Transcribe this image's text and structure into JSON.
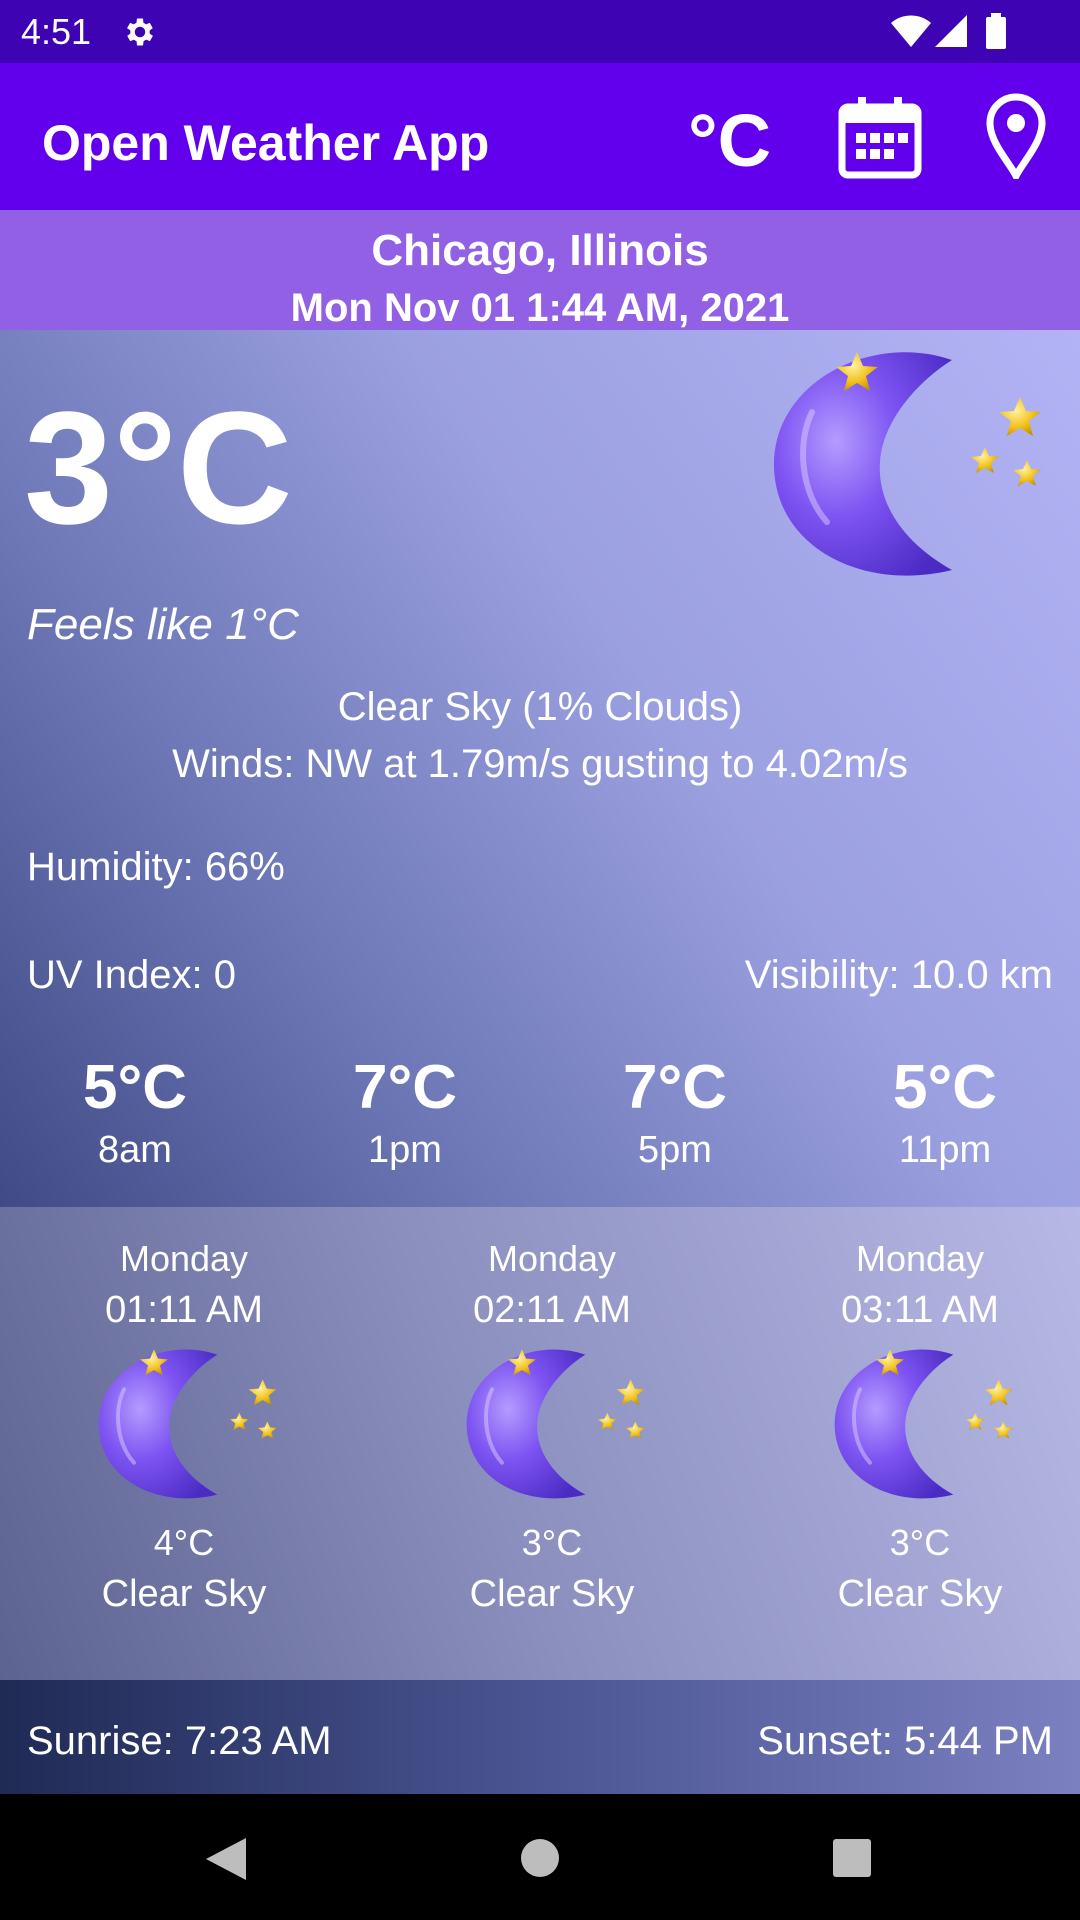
{
  "status_bar": {
    "time": "4:51",
    "icons": [
      "gear-icon",
      "wifi-icon",
      "signal-icon",
      "battery-icon"
    ]
  },
  "app_bar": {
    "title": "Open Weather App",
    "unit_toggle": "°C",
    "icons": [
      "calendar-icon",
      "location-pin-icon"
    ]
  },
  "location": {
    "city": "Chicago, Illinois",
    "datetime": "Mon Nov 01 1:44 AM, 2021"
  },
  "current": {
    "temperature": "3°C",
    "feels_like": "Feels like 1°C",
    "condition": "Clear Sky (1% Clouds)",
    "wind": "Winds: NW at 1.79m/s gusting to 4.02m/s",
    "humidity": "Humidity: 66%",
    "uv_index": "UV Index: 0",
    "visibility": "Visibility: 10.0 km",
    "icon": "moon-stars-icon"
  },
  "hourly": [
    {
      "temp": "5°C",
      "time": "8am"
    },
    {
      "temp": "7°C",
      "time": "1pm"
    },
    {
      "temp": "7°C",
      "time": "5pm"
    },
    {
      "temp": "5°C",
      "time": "11pm"
    }
  ],
  "forecast": [
    {
      "day": "Monday",
      "time": "01:11 AM",
      "temp": "4°C",
      "desc": "Clear Sky",
      "icon": "moon-stars-icon"
    },
    {
      "day": "Monday",
      "time": "02:11 AM",
      "temp": "3°C",
      "desc": "Clear Sky",
      "icon": "moon-stars-icon"
    },
    {
      "day": "Monday",
      "time": "03:11 AM",
      "temp": "3°C",
      "desc": "Clear Sky",
      "icon": "moon-stars-icon"
    }
  ],
  "sun": {
    "sunrise": "Sunrise: 7:23 AM",
    "sunset": "Sunset: 5:44 PM"
  },
  "nav_bar": {
    "icons": [
      "back-icon",
      "home-icon",
      "recents-icon"
    ]
  },
  "colors": {
    "status_bar": "#3e03b3",
    "app_bar": "#6200ee",
    "banner": "#9160e4",
    "moon": "#7a4ff0",
    "star": "#f2c21b"
  }
}
